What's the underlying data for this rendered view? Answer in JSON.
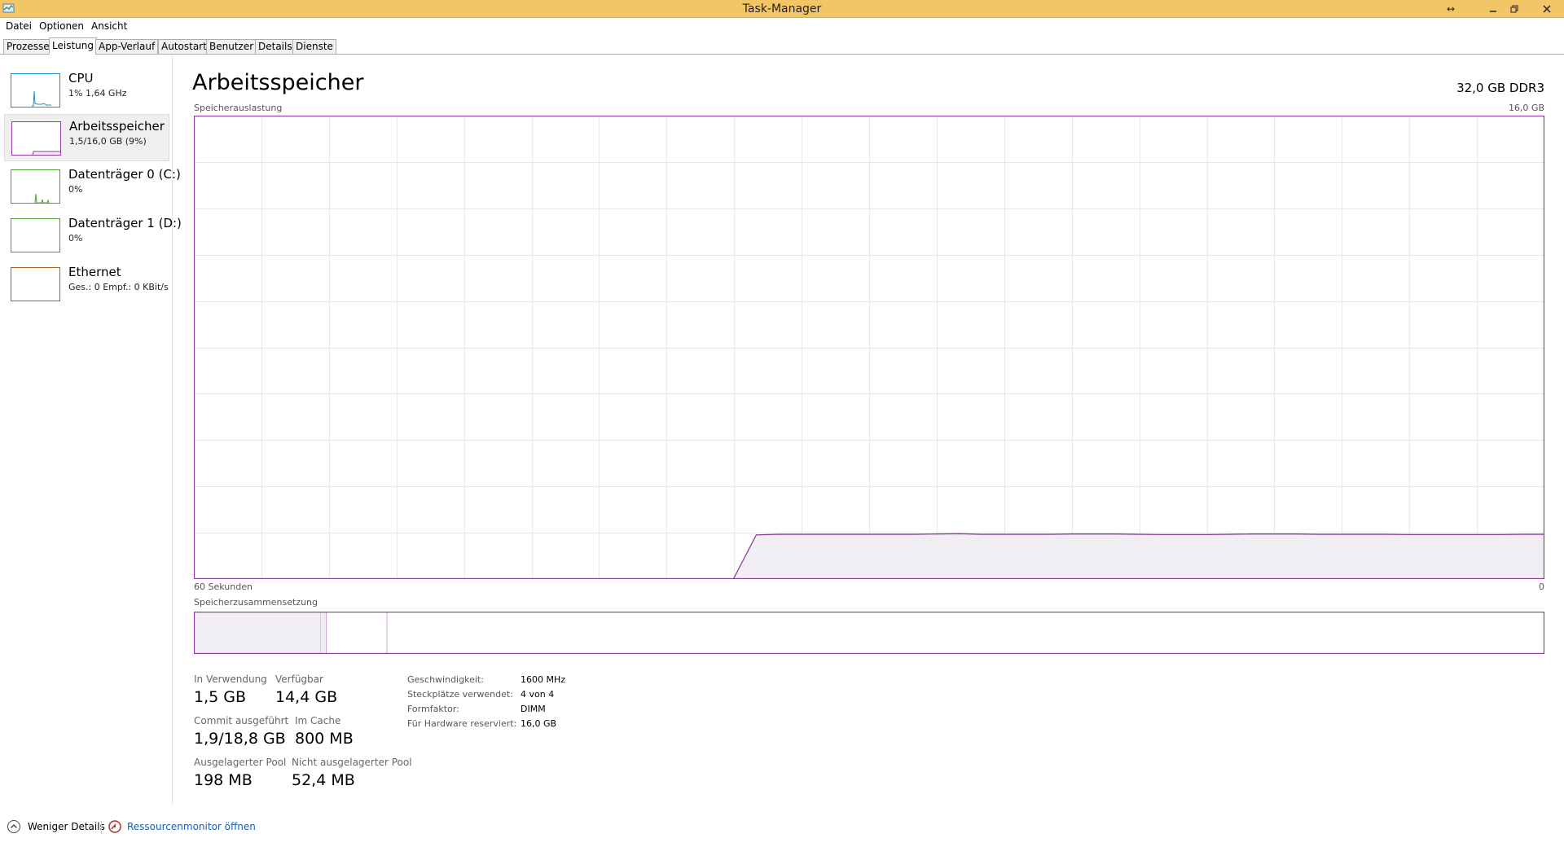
{
  "window": {
    "title": "Task-Manager"
  },
  "menu": [
    "Datei",
    "Optionen",
    "Ansicht"
  ],
  "tabs": [
    {
      "label": "Prozesse",
      "active": false
    },
    {
      "label": "Leistung",
      "active": true
    },
    {
      "label": "App-Verlauf",
      "active": false
    },
    {
      "label": "Autostart",
      "active": false
    },
    {
      "label": "Benutzer",
      "active": false
    },
    {
      "label": "Details",
      "active": false
    },
    {
      "label": "Dienste",
      "active": false
    }
  ],
  "sidebar": {
    "items": [
      {
        "name": "CPU",
        "sub": "1%  1,64 GHz",
        "color": "#1e90c8",
        "icon": "cpu-graph-icon"
      },
      {
        "name": "Arbeitsspeicher",
        "sub": "1,5/16,0 GB (9%)",
        "color": "#8b3f9c",
        "icon": "memory-graph-icon"
      },
      {
        "name": "Datenträger 0 (C:)",
        "sub": "0%",
        "color": "#4aa02c",
        "icon": "disk-graph-icon"
      },
      {
        "name": "Datenträger 1 (D:)",
        "sub": "0%",
        "color": "#4aa02c",
        "icon": "disk-graph-icon"
      },
      {
        "name": "Ethernet",
        "sub": "Ges.: 0 Empf.: 0 KBit/s",
        "color": "#b05d1a",
        "icon": "ethernet-graph-icon"
      }
    ]
  },
  "main": {
    "title": "Arbeitsspeicher",
    "spec": "32,0 GB DDR3",
    "usage_label": "Speicherauslastung",
    "usage_max": "16,0 GB",
    "time_left": "60 Sekunden",
    "time_right": "0",
    "composition_label": "Speicherzusammensetzung"
  },
  "stats": {
    "in_use_label": "In Verwendung",
    "in_use": "1,5 GB",
    "available_label": "Verfügbar",
    "available": "14,4 GB",
    "committed_label": "Commit ausgeführt",
    "committed": "1,9/18,8 GB",
    "cached_label": "Im Cache",
    "cached": "800 MB",
    "paged_label": "Ausgelagerter Pool",
    "paged": "198 MB",
    "nonpaged_label": "Nicht ausgelagerter Pool",
    "nonpaged": "52,4 MB"
  },
  "specs": [
    {
      "label": "Geschwindigkeit:",
      "value": "1600 MHz"
    },
    {
      "label": "Steckplätze verwendet:",
      "value": "4 von 4"
    },
    {
      "label": "Formfaktor:",
      "value": "DIMM"
    },
    {
      "label": "Für Hardware reserviert:",
      "value": "16,0 GB"
    }
  ],
  "footer": {
    "fewer_details": "Weniger Details",
    "resource_monitor": "Ressourcenmonitor öffnen"
  },
  "colors": {
    "memory": "#8b3f9c",
    "memory_fill": "#f1eef3",
    "grid": "#e8e8e8",
    "titlebar": "#f2c566"
  },
  "chart_data": {
    "type": "area",
    "x_unit": "seconds ago",
    "x": [
      60,
      59,
      58,
      57,
      56,
      55,
      54,
      53,
      52,
      51,
      50,
      49,
      48,
      47,
      46,
      45,
      44,
      43,
      42,
      41,
      40,
      39,
      38,
      37,
      36,
      35,
      34,
      33,
      32,
      31,
      30,
      29,
      28,
      27,
      26,
      25,
      24,
      23,
      22,
      21,
      20,
      19,
      18,
      17,
      16,
      15,
      14,
      13,
      12,
      11,
      10,
      9,
      8,
      7,
      6,
      5,
      4,
      3,
      2,
      1,
      0
    ],
    "y": [
      null,
      null,
      null,
      null,
      null,
      null,
      null,
      null,
      null,
      null,
      null,
      null,
      null,
      null,
      null,
      null,
      null,
      null,
      null,
      null,
      null,
      null,
      null,
      null,
      0,
      1.5,
      1.52,
      1.52,
      1.52,
      1.52,
      1.52,
      1.52,
      1.52,
      1.53,
      1.54,
      1.52,
      1.52,
      1.52,
      1.52,
      1.53,
      1.53,
      1.53,
      1.52,
      1.51,
      1.51,
      1.51,
      1.52,
      1.53,
      1.53,
      1.53,
      1.52,
      1.52,
      1.52,
      1.52,
      1.51,
      1.51,
      1.51,
      1.51,
      1.51,
      1.52,
      1.52
    ],
    "ylim": [
      0,
      16
    ],
    "y_unit": "GB",
    "grid": true
  },
  "composition": {
    "in_use_fraction": 0.094,
    "modified_fraction": 0.004,
    "standby_fraction": 0.045
  }
}
